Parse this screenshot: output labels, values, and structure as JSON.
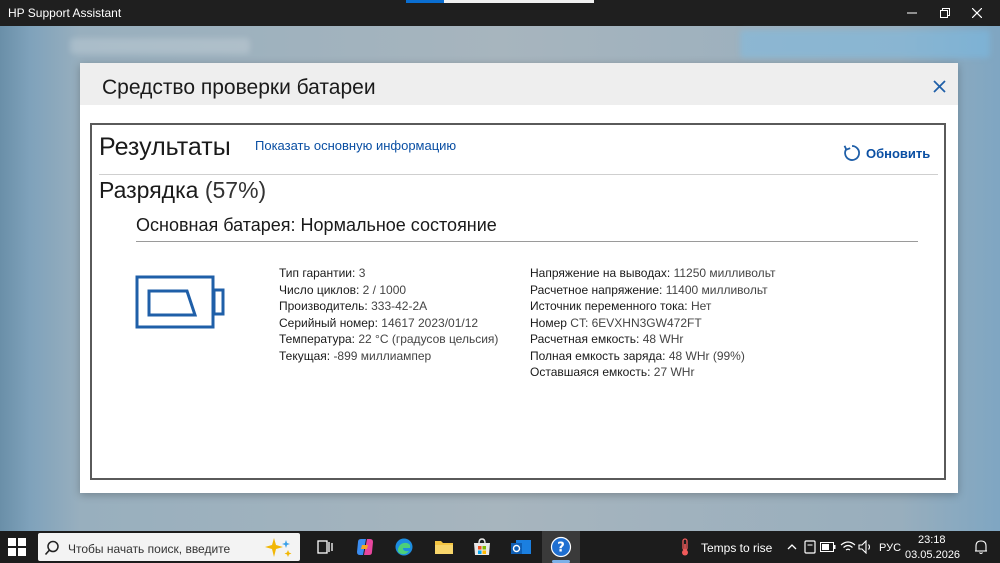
{
  "window": {
    "title": "HP Support Assistant"
  },
  "modal": {
    "title": "Средство проверки батареи",
    "results_title": "Результаты",
    "show_info_link": "Показать основную информацию",
    "refresh_label": "Обновить",
    "discharge_label": "Разрядка",
    "discharge_percent": "(57%)",
    "battery_heading": "Основная батарея: Нормальное состояние",
    "left_info": [
      {
        "label": "Тип гарантии:",
        "value": "3"
      },
      {
        "label": "Число циклов:",
        "value": "2 / 1000"
      },
      {
        "label": "Производитель:",
        "value": "333-42-2A"
      },
      {
        "label": "Серийный номер:",
        "value": "14617 2023/01/12"
      },
      {
        "label": "Температура:",
        "value": "22 °C (градусов цельсия)"
      },
      {
        "label": "Текущая:",
        "value": "-899 миллиампер"
      }
    ],
    "right_info": [
      {
        "label": "Напряжение на выводах:",
        "value": "11250 милливольт"
      },
      {
        "label": "Расчетное напряжение:",
        "value": "11400 милливольт"
      },
      {
        "label": "Источник переменного тока:",
        "value": "Нет"
      },
      {
        "label": "Номер",
        "value": "CT: 6EVXHN3GW472FT"
      },
      {
        "label": "Расчетная емкость:",
        "value": "48 WHr"
      },
      {
        "label": "Полная емкость заряда:",
        "value": "48 WHr (99%)"
      },
      {
        "label": "Оставшаяся емкость:",
        "value": "27 WHr"
      }
    ]
  },
  "taskbar": {
    "search_placeholder": "Чтобы начать поиск, введите",
    "weather": "Temps to rise",
    "language": "РУС",
    "time": "23:18",
    "date": "03.05.2026"
  },
  "colors": {
    "accent_link": "#0a4fa3",
    "battery_icon": "#1f5fa8",
    "titlebar": "#1f1f1f",
    "taskbar": "#1c1c1c"
  },
  "icons": {
    "refresh": "refresh-icon",
    "battery": "battery-icon",
    "close": "close-icon",
    "start": "windows-start-icon",
    "search": "search-icon",
    "help": "help-icon"
  }
}
